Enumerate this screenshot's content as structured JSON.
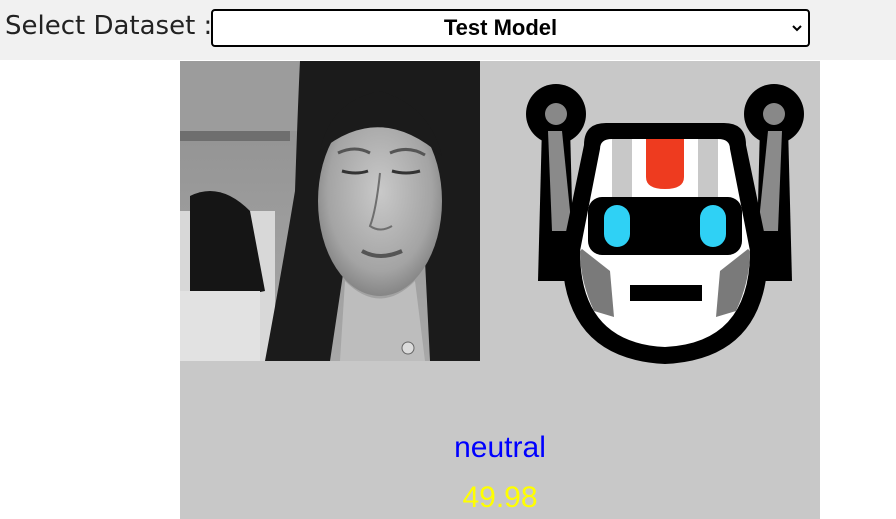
{
  "header": {
    "label": "Select Dataset :",
    "dataset_select": {
      "selected": "Test Model"
    }
  },
  "prediction": {
    "emotion": "neutral",
    "score": "49.98"
  },
  "colors": {
    "emotion_text": "#0000ff",
    "score_text": "#ffff00",
    "stage_background": "#c8c8c8",
    "robot_accent_red": "#ee3b1f",
    "robot_eye_blue": "#2fd1f5"
  },
  "icons": {
    "robot": "robot-face-icon",
    "select_arrow": "chevron-down-icon"
  }
}
